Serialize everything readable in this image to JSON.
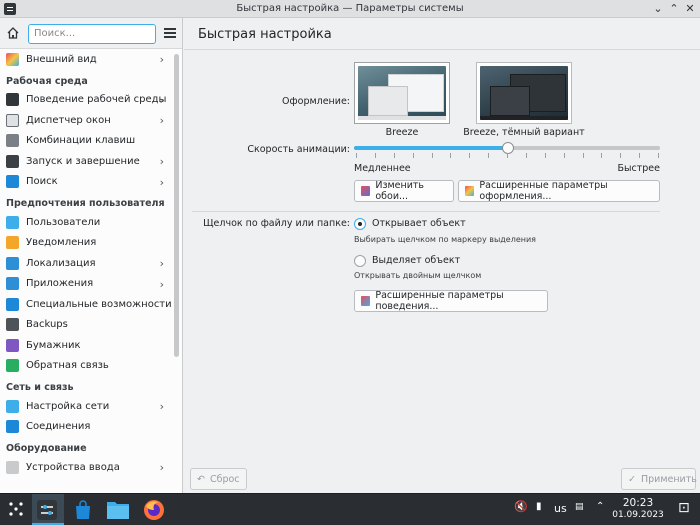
{
  "window": {
    "title": "Быстрая настройка — Параметры системы",
    "min_glyph": "⌄",
    "max_glyph": "⌃",
    "close_glyph": "✕"
  },
  "sidebar": {
    "search_placeholder": "Поиск...",
    "top_items": [
      {
        "label": "Внешний вид",
        "icon": "appearance-icon",
        "chevron": true
      }
    ],
    "sections": [
      {
        "title": "Рабочая среда",
        "items": [
          {
            "label": "Поведение рабочей среды",
            "icon": "workspace-behavior-icon",
            "chevron": true
          },
          {
            "label": "Диспетчер окон",
            "icon": "window-manager-icon",
            "chevron": true
          },
          {
            "label": "Комбинации клавиш",
            "icon": "keyboard-icon",
            "chevron": false
          },
          {
            "label": "Запуск и завершение",
            "icon": "startup-icon",
            "chevron": true
          },
          {
            "label": "Поиск",
            "icon": "search-icon",
            "chevron": true
          }
        ]
      },
      {
        "title": "Предпочтения пользователя",
        "items": [
          {
            "label": "Пользователи",
            "icon": "users-icon",
            "chevron": false
          },
          {
            "label": "Уведомления",
            "icon": "bell-icon",
            "chevron": false
          },
          {
            "label": "Локализация",
            "icon": "localization-icon",
            "chevron": true
          },
          {
            "label": "Приложения",
            "icon": "apps-icon",
            "chevron": true
          },
          {
            "label": "Специальные возможности",
            "icon": "accessibility-icon",
            "chevron": false
          },
          {
            "label": "Backups",
            "icon": "backup-icon",
            "chevron": false
          },
          {
            "label": "Бумажник",
            "icon": "wallet-icon",
            "chevron": false
          },
          {
            "label": "Обратная связь",
            "icon": "feedback-icon",
            "chevron": false
          }
        ]
      },
      {
        "title": "Сеть и связь",
        "items": [
          {
            "label": "Настройка сети",
            "icon": "network-icon",
            "chevron": true
          },
          {
            "label": "Соединения",
            "icon": "connections-icon",
            "chevron": false
          }
        ]
      },
      {
        "title": "Оборудование",
        "items": [
          {
            "label": "Устройства ввода",
            "icon": "input-devices-icon",
            "chevron": true
          }
        ]
      }
    ]
  },
  "main": {
    "title": "Быстрая настройка",
    "appearance_label": "Оформление:",
    "themes": [
      {
        "name": "Breeze",
        "selected": true
      },
      {
        "name": "Breeze, тёмный вариант",
        "selected": false
      }
    ],
    "animation_label": "Скорость анимации:",
    "slider_value": 0.5,
    "slider_min_label": "Медленнее",
    "slider_max_label": "Быстрее",
    "change_wallpaper_button": "Изменить обои...",
    "advanced_appearance_button": "Расширенные параметры оформления...",
    "click_label": "Щелчок по файлу или папке:",
    "click_options": [
      {
        "label": "Открывает объект",
        "hint": "Выбирать щелчком по маркеру выделения",
        "checked": true
      },
      {
        "label": "Выделяет объект",
        "hint": "Открывать двойным щелчком",
        "checked": false
      }
    ],
    "advanced_behavior_button": "Расширенные параметры поведения...",
    "reset_button": "Сброс",
    "apply_button": "Применить"
  },
  "taskbar": {
    "keyboard_layout": "us",
    "time": "20:23",
    "date": "01.09.2023"
  },
  "colors": {
    "accent": "#3daee9",
    "taskbar": "#2a2e32"
  }
}
